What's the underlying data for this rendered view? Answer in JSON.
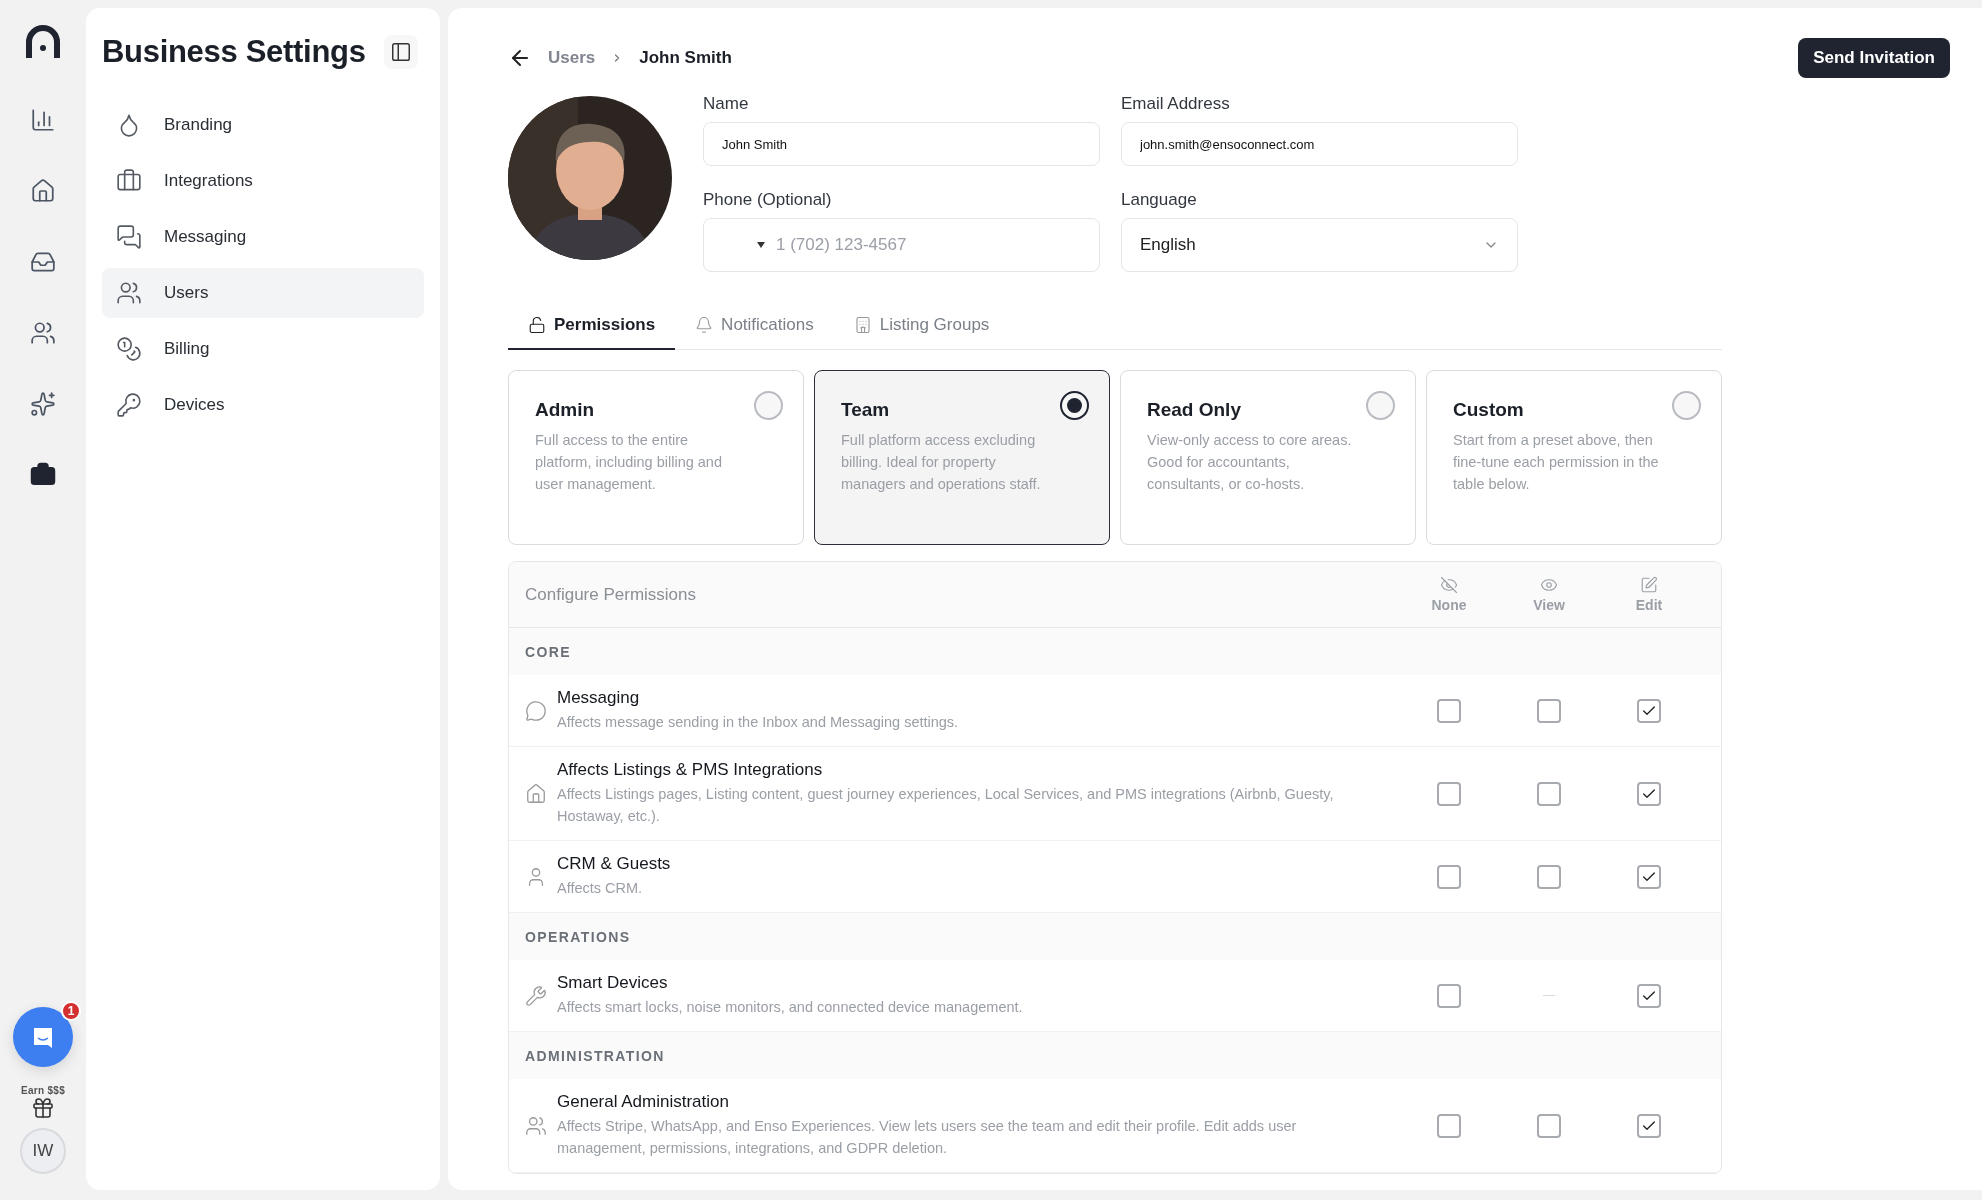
{
  "rail": {
    "items": [
      {
        "selected": false
      },
      {
        "selected": false
      },
      {
        "selected": false
      },
      {
        "selected": false
      },
      {
        "selected": false
      },
      {
        "selected": true
      }
    ],
    "chat_badge": "1",
    "earn_label": "Earn $$$",
    "user_initials": "IW"
  },
  "sidebar": {
    "title": "Business Settings",
    "items": [
      {
        "label": "Branding",
        "selected": false
      },
      {
        "label": "Integrations",
        "selected": false
      },
      {
        "label": "Messaging",
        "selected": false
      },
      {
        "label": "Users",
        "selected": true
      },
      {
        "label": "Billing",
        "selected": false
      },
      {
        "label": "Devices",
        "selected": false
      }
    ]
  },
  "header": {
    "breadcrumb": [
      "Users",
      "John Smith"
    ],
    "action": "Send Invitation"
  },
  "profile": {
    "fields": [
      {
        "kind": "text",
        "label": "Name",
        "value": "John Smith"
      },
      {
        "kind": "text",
        "label": "Email Address",
        "value": "john.smith@ensoconnect.com"
      },
      {
        "kind": "phone",
        "label": "Phone (Optional)",
        "placeholder": "1 (702) 123-4567"
      },
      {
        "kind": "select",
        "label": "Language",
        "value": "English"
      }
    ]
  },
  "tabs": [
    {
      "label": "Permissions",
      "selected": true
    },
    {
      "label": "Notifications",
      "selected": false
    },
    {
      "label": "Listing Groups",
      "selected": false
    }
  ],
  "roles": [
    {
      "title": "Admin",
      "description": "Full access to the entire platform, including billing and user management.",
      "selected": false
    },
    {
      "title": "Team",
      "description": "Full platform access excluding billing. Ideal for property managers and operations staff.",
      "selected": true
    },
    {
      "title": "Read Only",
      "description": "View-only access to core areas. Good for accountants, consultants, or co-hosts.",
      "selected": false
    },
    {
      "title": "Custom",
      "description": "Start from a preset above, then fine-tune each permission in the table below.",
      "selected": false
    }
  ],
  "permissions": {
    "title": "Configure Permissions",
    "columns": [
      "None",
      "View",
      "Edit"
    ],
    "sections": [
      {
        "title": "CORE",
        "rows": [
          {
            "name": "Messaging",
            "description": "Affects message sending in the Inbox and Messaging settings.",
            "cells": [
              {
                "kind": "checkbox",
                "checked": false
              },
              {
                "kind": "checkbox",
                "checked": false
              },
              {
                "kind": "checkbox",
                "checked": true
              }
            ]
          },
          {
            "name": "Affects Listings & PMS Integrations",
            "description": "Affects Listings pages, Listing content, guest journey experiences, Local Services, and PMS integrations (Airbnb, Guesty, Hostaway, etc.).",
            "cells": [
              {
                "kind": "checkbox",
                "checked": false
              },
              {
                "kind": "checkbox",
                "checked": false
              },
              {
                "kind": "checkbox",
                "checked": true
              }
            ]
          },
          {
            "name": "CRM & Guests",
            "description": "Affects CRM.",
            "cells": [
              {
                "kind": "checkbox",
                "checked": false
              },
              {
                "kind": "checkbox",
                "checked": false
              },
              {
                "kind": "checkbox",
                "checked": true
              }
            ]
          }
        ]
      },
      {
        "title": "OPERATIONS",
        "rows": [
          {
            "name": "Smart Devices",
            "description": "Affects smart locks, noise monitors, and connected device management.",
            "cells": [
              {
                "kind": "checkbox",
                "checked": false
              },
              {
                "kind": "unavailable"
              },
              {
                "kind": "checkbox",
                "checked": true
              }
            ]
          }
        ]
      },
      {
        "title": "ADMINISTRATION",
        "rows": [
          {
            "name": "General Administration",
            "description": "Affects Stripe, WhatsApp, and Enso Experiences. View lets users see the team and edit their profile. Edit adds user management, permissions, integrations, and GDPR deletion.",
            "cells": [
              {
                "kind": "checkbox",
                "checked": false
              },
              {
                "kind": "checkbox",
                "checked": false
              },
              {
                "kind": "checkbox",
                "checked": true
              }
            ]
          }
        ]
      }
    ]
  }
}
